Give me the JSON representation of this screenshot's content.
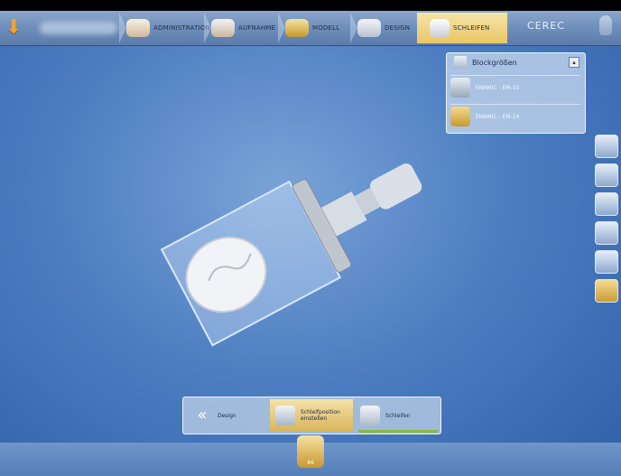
{
  "nav": {
    "tabs": [
      {
        "label": "ADMINISTRATION",
        "icon": "dentition-icon"
      },
      {
        "label": "AUFNAHME",
        "icon": "scan-icon"
      },
      {
        "label": "MODELL",
        "icon": "model-icon"
      },
      {
        "label": "DESIGN",
        "icon": "design-icon"
      },
      {
        "label": "SCHLEIFEN",
        "icon": "milling-icon"
      }
    ],
    "brand": "CEREC"
  },
  "panel": {
    "title": "Blockgrößen",
    "items": [
      {
        "label": "ENAMIC - EM-10",
        "selected": false
      },
      {
        "label": "ENAMIC - EM-14",
        "selected": true
      }
    ]
  },
  "bottom": {
    "steps": [
      {
        "label": "Design"
      },
      {
        "label": "Schleifposition\neinstellen",
        "active": true
      },
      {
        "label": "Schleifen"
      }
    ]
  },
  "counter": {
    "value": "46"
  },
  "colors": {
    "accent": "#e8c765",
    "background": "#4f7fc2",
    "progress": "#8bb83a"
  }
}
